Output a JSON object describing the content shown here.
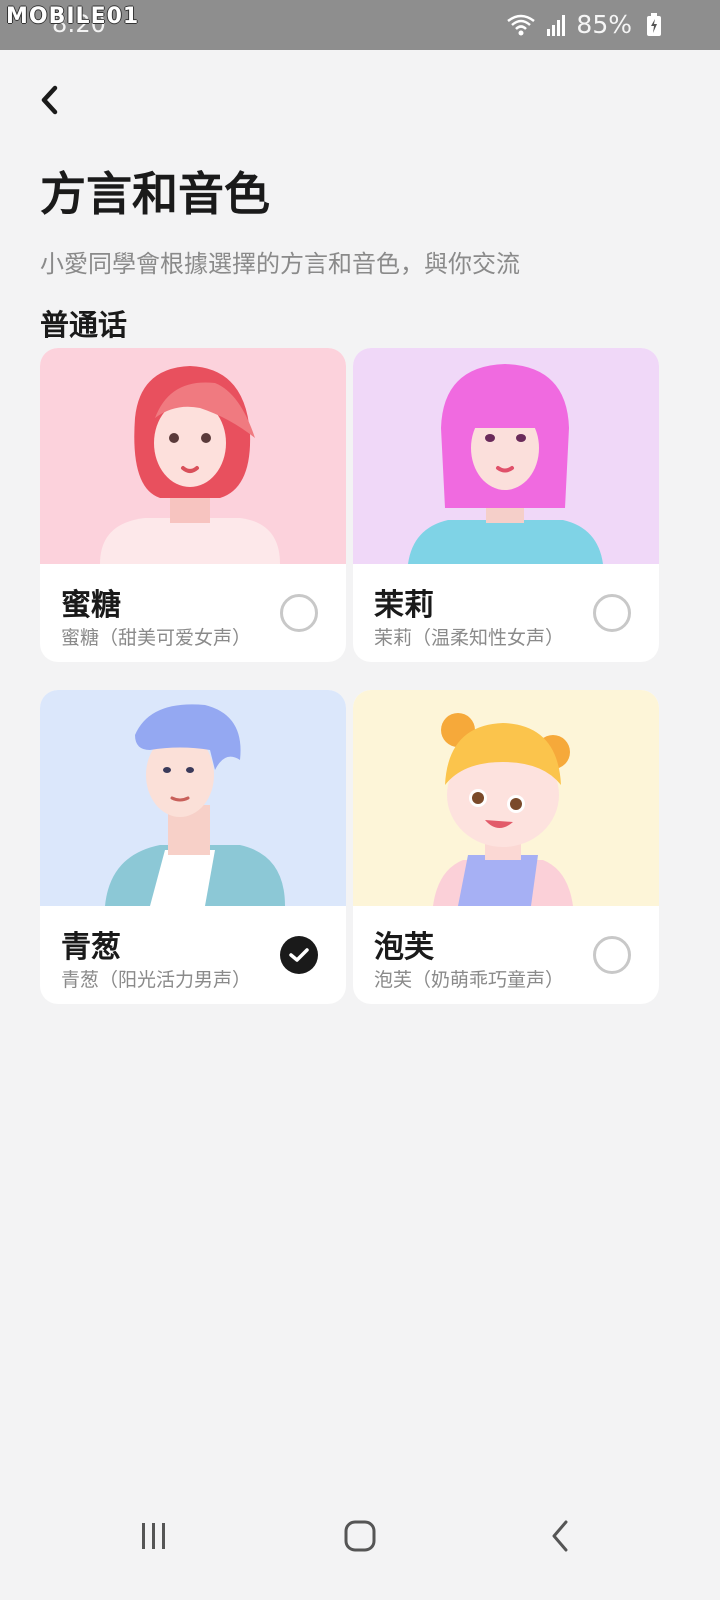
{
  "status_bar": {
    "time": "8:20",
    "watermark": "MOBILE01",
    "battery": "85%",
    "icons": [
      "wifi-icon",
      "signal-icon",
      "battery-charging-icon"
    ]
  },
  "header": {
    "back_icon": "chevron-left-icon",
    "title": "方言和音色",
    "subtitle": "小愛同學會根據選擇的方言和音色，與你交流"
  },
  "section": {
    "title": "普通话"
  },
  "voices": [
    {
      "name": "蜜糖",
      "description": "蜜糖（甜美可爱女声）",
      "selected": false,
      "bg": "#fcd2dc"
    },
    {
      "name": "茉莉",
      "description": "茉莉（温柔知性女声）",
      "selected": false,
      "bg": "#f0d8f8"
    },
    {
      "name": "青葱",
      "description": "青葱（阳光活力男声）",
      "selected": true,
      "bg": "#dbe7fb"
    },
    {
      "name": "泡芙",
      "description": "泡芙（奶萌乖巧童声）",
      "selected": false,
      "bg": "#fdf5d8"
    }
  ],
  "nav": {
    "icons": [
      "recent-apps-icon",
      "home-icon",
      "back-icon"
    ]
  },
  "colors": {
    "background": "#f3f3f4",
    "accent": "#1a1a1a",
    "muted_text": "#8a8a8a"
  }
}
